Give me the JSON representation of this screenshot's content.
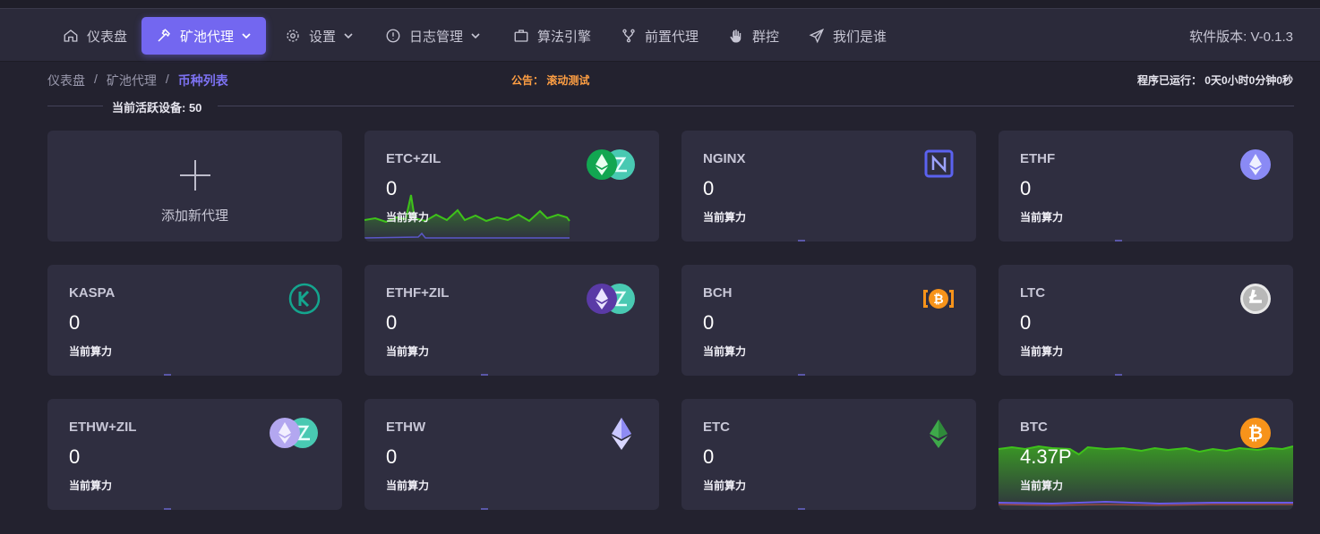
{
  "nav": {
    "items": [
      {
        "label": "仪表盘",
        "icon": "home-icon"
      },
      {
        "label": "矿池代理",
        "icon": "hammer-icon"
      },
      {
        "label": "设置",
        "icon": "gear-icon"
      },
      {
        "label": "日志管理",
        "icon": "alert-circle-icon"
      },
      {
        "label": "算法引擎",
        "icon": "briefcase-icon"
      },
      {
        "label": "前置代理",
        "icon": "git-branch-icon"
      },
      {
        "label": "群控",
        "icon": "hand-icon"
      },
      {
        "label": "我们是谁",
        "icon": "send-icon"
      }
    ],
    "active_index": 1,
    "version": "软件版本: V-0.1.3"
  },
  "breadcrumb": {
    "items": [
      "仪表盘",
      "矿池代理",
      "币种列表"
    ],
    "separator": "/"
  },
  "notice": "公告：  滚动测试",
  "uptime": "程序已运行：  0天0小时0分钟0秒",
  "active_devices": "当前活跃设备: 50",
  "add_card": {
    "label": "添加新代理"
  },
  "hash_label": "当前算力",
  "colors": {
    "accent": "#7367f0",
    "notice": "#ff9f43",
    "spark_green": "#3ec21a"
  },
  "cards": [
    {
      "name": "ETC+ZIL",
      "value": "0",
      "icon": "etc-zil-icon"
    },
    {
      "name": "NGINX",
      "value": "0",
      "icon": "nginx-icon"
    },
    {
      "name": "ETHF",
      "value": "0",
      "icon": "ethf-icon"
    },
    {
      "name": "KASPA",
      "value": "0",
      "icon": "kaspa-icon"
    },
    {
      "name": "ETHF+ZIL",
      "value": "0",
      "icon": "ethf-zil-icon"
    },
    {
      "name": "BCH",
      "value": "0",
      "icon": "bch-icon"
    },
    {
      "name": "LTC",
      "value": "0",
      "icon": "ltc-icon"
    },
    {
      "name": "ETHW+ZIL",
      "value": "0",
      "icon": "ethw-zil-icon"
    },
    {
      "name": "ETHW",
      "value": "0",
      "icon": "ethw-icon"
    },
    {
      "name": "ETC",
      "value": "0",
      "icon": "etc-icon"
    },
    {
      "name": "BTC",
      "value": "4.37P",
      "icon": "btc-icon"
    }
  ]
}
